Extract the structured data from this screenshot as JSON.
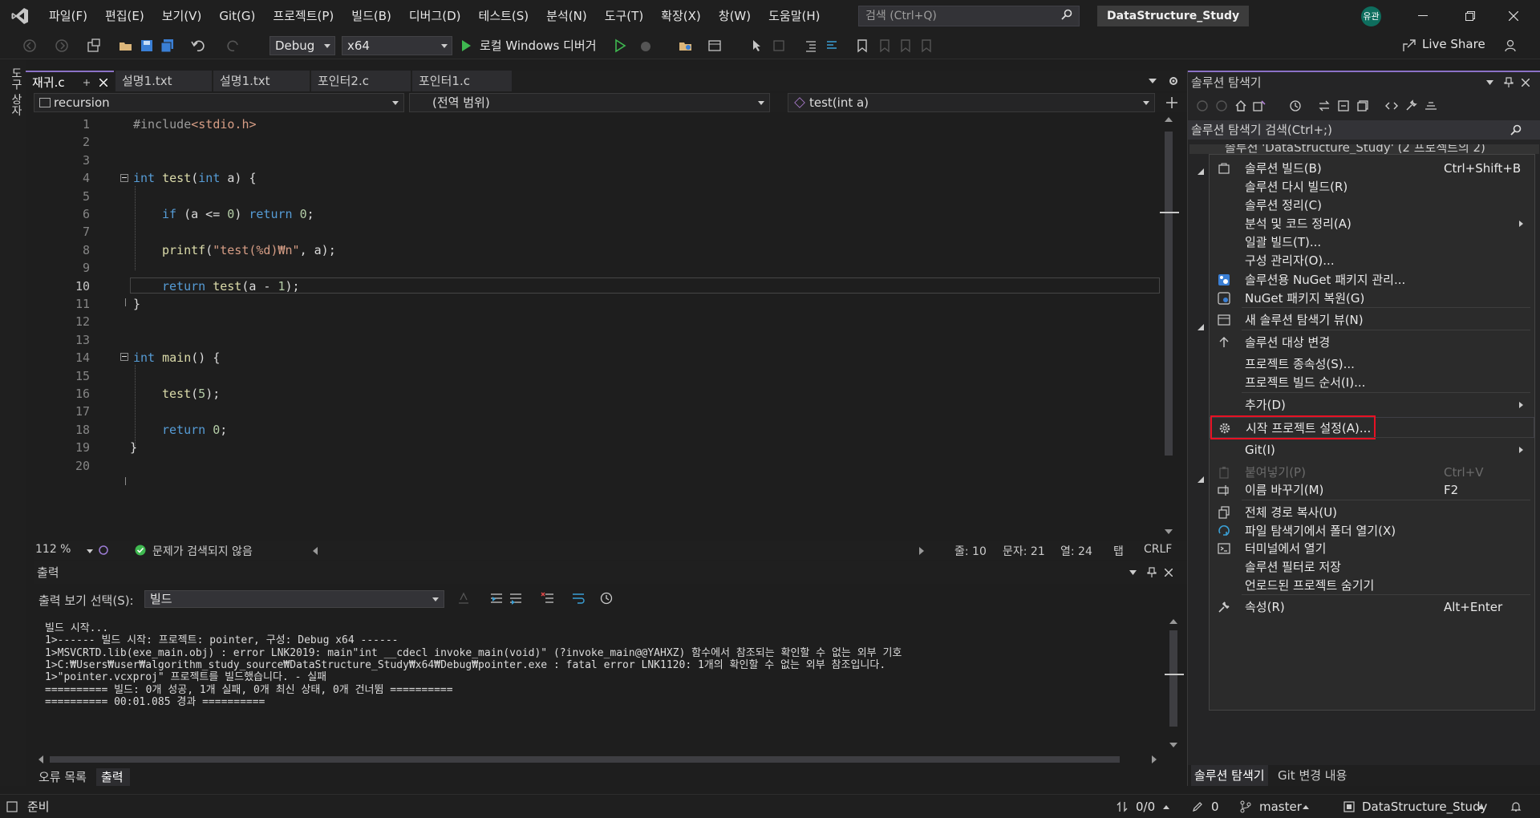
{
  "menubar": {
    "items": [
      "파일(F)",
      "편집(E)",
      "보기(V)",
      "Git(G)",
      "프로젝트(P)",
      "빌드(B)",
      "디버그(D)",
      "테스트(S)",
      "분석(N)",
      "도구(T)",
      "확장(X)",
      "창(W)",
      "도움말(H)"
    ],
    "search_placeholder": "검색 (Ctrl+Q)",
    "solution_title": "DataStructure_Study",
    "avatar_initials": "유관"
  },
  "toolbar": {
    "config": "Debug",
    "platform": "x64",
    "debugger_label": "로컬 Windows 디버거",
    "live_share": "Live Share"
  },
  "left_strip_label": "도구 상자",
  "doc_tabs": [
    "재귀.c",
    "설명1.txt",
    "설명1.txt",
    "포인터2.c",
    "포인터1.c"
  ],
  "navbar": {
    "project": "recursion",
    "scope": "(전역 범위)",
    "member": "test(int a)"
  },
  "editor": {
    "lines": [
      "1",
      "2",
      "3",
      "4",
      "5",
      "6",
      "7",
      "8",
      "9",
      "10",
      "11",
      "12",
      "13",
      "14",
      "15",
      "16",
      "17",
      "18",
      "19",
      "20"
    ],
    "current_line": "10",
    "code": {
      "l1_pp": "#include",
      "l1_inc": "<stdio.h>",
      "l4_kw": "int",
      "l4_fn": "test",
      "l4_kw2": "int",
      "l4_rest": " a) {",
      "l6_kw": "if",
      "l6_mid": " (a <= ",
      "l6_num": "0",
      "l6_mid2": ") ",
      "l6_kw2": "return",
      "l6_num2": " 0",
      "l6_end": ";",
      "l8_fn": "printf",
      "l8_str": "\"test(%d)₩n\"",
      "l8_rest": ", a);",
      "l10_kw": "return",
      "l10_fn": "test",
      "l10_mid": "(a - ",
      "l10_num": "1",
      "l10_end": ");",
      "l11": "}",
      "l14_kw": "int",
      "l14_fn": "main",
      "l14_rest": "() {",
      "l16_fn": "test",
      "l16_open": "(",
      "l16_num": "5",
      "l16_end": ");",
      "l18_kw": "return",
      "l18_num": " 0",
      "l18_end": ";",
      "l19": "}"
    }
  },
  "editor_status": {
    "zoom": "112 %",
    "issues": "문제가 검색되지 않음",
    "line": "줄: 10",
    "char": "문자: 21",
    "col": "열: 24",
    "tab": "탭",
    "eol": "CRLF"
  },
  "output": {
    "title": "출력",
    "select_label": "출력 보기 선택(S):",
    "select_value": "빌드",
    "lines": [
      "빌드 시작...",
      "1>------ 빌드 시작: 프로젝트: pointer, 구성: Debug x64 ------",
      "1>MSVCRTD.lib(exe_main.obj) : error LNK2019: main\"int __cdecl invoke_main(void)\" (?invoke_main@@YAHXZ) 함수에서 참조되는 확인할 수 없는 외부 기호",
      "1>C:₩Users₩user₩algorithm_study_source₩DataStructure_Study₩x64₩Debug₩pointer.exe : fatal error LNK1120: 1개의 확인할 수 없는 외부 참조입니다.",
      "1>\"pointer.vcxproj\" 프로젝트를 빌드했습니다. - 실패",
      "========== 빌드: 0개 성공, 1개 실패, 0개 최신 상태, 0개 건너뜀 ==========",
      "========== 00:01.085 경과 =========="
    ],
    "bottom_tabs": [
      "오류 목록",
      "출력"
    ]
  },
  "solution_explorer": {
    "title": "솔루션 탐색기",
    "search_placeholder": "솔루션 탐색기 검색(Ctrl+;)",
    "root_item": "솔루션 'DataStructure_Study' (2 프로젝트의 2)",
    "bottom_tabs": [
      "솔루션 탐색기",
      "Git 변경 내용"
    ]
  },
  "context_menu": {
    "items": [
      {
        "label": "솔루션 빌드(B)",
        "shortcut": "Ctrl+Shift+B",
        "icon": "build-icon"
      },
      {
        "label": "솔루션 다시 빌드(R)",
        "shortcut": "",
        "icon": ""
      },
      {
        "label": "솔루션 정리(C)",
        "shortcut": "",
        "icon": ""
      },
      {
        "label": "분석 및 코드 정리(A)",
        "shortcut": "",
        "icon": "",
        "submenu": true
      },
      {
        "label": "일괄 빌드(T)...",
        "shortcut": "",
        "icon": ""
      },
      {
        "label": "구성 관리자(O)...",
        "shortcut": "",
        "icon": ""
      },
      {
        "label": "솔루션용 NuGet 패키지 관리...",
        "shortcut": "",
        "icon": "nuget-icon"
      },
      {
        "label": "NuGet 패키지 복원(G)",
        "shortcut": "",
        "icon": "nuget-restore-icon"
      },
      {
        "label": "새 솔루션 탐색기 뷰(N)",
        "shortcut": "",
        "icon": "new-view-icon"
      },
      {
        "label": "솔루션 대상 변경",
        "shortcut": "",
        "icon": "arrow-up-icon"
      },
      {
        "label": "프로젝트 종속성(S)...",
        "shortcut": "",
        "icon": ""
      },
      {
        "label": "프로젝트 빌드 순서(I)...",
        "shortcut": "",
        "icon": ""
      },
      {
        "label": "추가(D)",
        "shortcut": "",
        "icon": "",
        "submenu": true
      },
      {
        "label": "시작 프로젝트 설정(A)...",
        "shortcut": "",
        "icon": "gear-icon"
      },
      {
        "label": "Git(I)",
        "shortcut": "",
        "icon": "",
        "submenu": true
      },
      {
        "label": "붙여넣기(P)",
        "shortcut": "Ctrl+V",
        "icon": "paste-icon",
        "disabled": true
      },
      {
        "label": "이름 바꾸기(M)",
        "shortcut": "F2",
        "icon": "rename-icon"
      },
      {
        "label": "전체 경로 복사(U)",
        "shortcut": "",
        "icon": "copy-icon"
      },
      {
        "label": "파일 탐색기에서 폴더 열기(X)",
        "shortcut": "",
        "icon": "open-folder-icon"
      },
      {
        "label": "터미널에서 열기",
        "shortcut": "",
        "icon": "terminal-icon"
      },
      {
        "label": "솔루션 필터로 저장",
        "shortcut": "",
        "icon": ""
      },
      {
        "label": "언로드된 프로젝트 숨기기",
        "shortcut": "",
        "icon": ""
      },
      {
        "label": "속성(R)",
        "shortcut": "Alt+Enter",
        "icon": "wrench-icon"
      }
    ]
  },
  "statusbar": {
    "ready": "준비",
    "changes": "0/0",
    "edits": "0",
    "branch": "master",
    "repo": "DataStructure_Study"
  },
  "colors": {
    "accent": "#8b72c7",
    "highlight_box": "#e81123",
    "keyword": "#569cd6",
    "function": "#dcdcaa",
    "string": "#d69d85"
  }
}
